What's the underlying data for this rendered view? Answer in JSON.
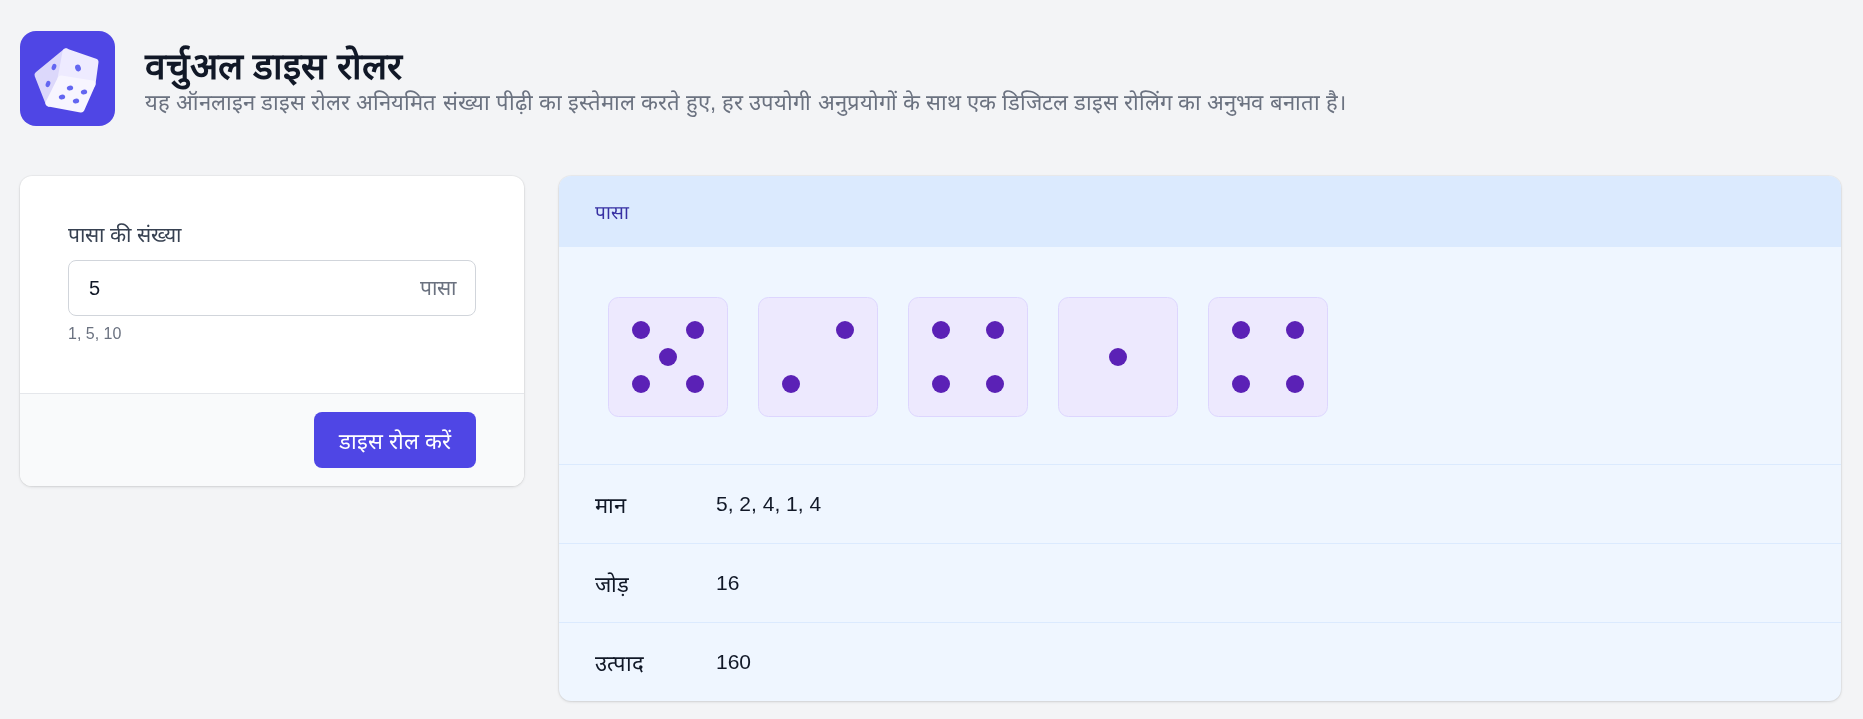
{
  "header": {
    "title": "वर्चुअल डाइस रोलर",
    "subtitle": "यह ऑनलाइन डाइस रोलर अनियमित संख्या पीढ़ी का इस्तेमाल करते हुए, हर उपयोगी अनुप्रयोगों के साथ एक डिजिटल डाइस रोलिंग का अनुभव बनाता है।"
  },
  "form": {
    "label": "पासा की संख्या",
    "value": "5",
    "suffix": "पासा",
    "hint": "1, 5, 10",
    "button": "डाइस रोल करें"
  },
  "results": {
    "title": "पासा",
    "dice": [
      {
        "kind": "five"
      },
      {
        "kind": "two"
      },
      {
        "kind": "four"
      },
      {
        "kind": "one"
      },
      {
        "kind": "four"
      }
    ],
    "rows": [
      {
        "label": "मान",
        "value": "5, 2, 4, 1, 4"
      },
      {
        "label": "जोड़",
        "value": "16"
      },
      {
        "label": "उत्पाद",
        "value": "160"
      }
    ]
  }
}
